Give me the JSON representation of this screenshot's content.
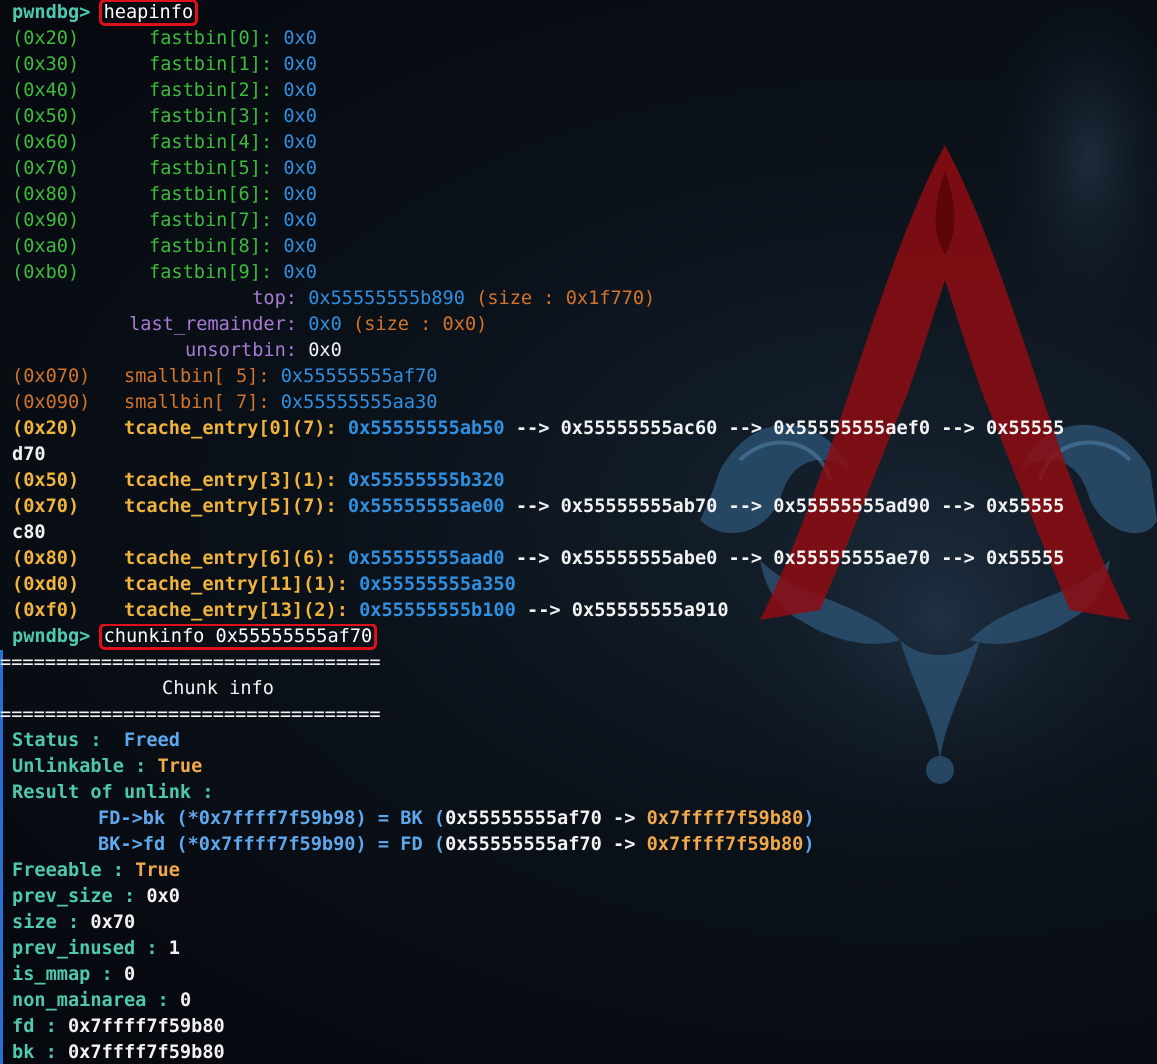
{
  "prompt": "pwndbg>",
  "commands": {
    "heapinfo": "heapinfo",
    "chunkinfo": "chunkinfo 0x55555555af70"
  },
  "fastbins": [
    {
      "size": "(0x20)",
      "label": "fastbin[0]:",
      "value": "0x0"
    },
    {
      "size": "(0x30)",
      "label": "fastbin[1]:",
      "value": "0x0"
    },
    {
      "size": "(0x40)",
      "label": "fastbin[2]:",
      "value": "0x0"
    },
    {
      "size": "(0x50)",
      "label": "fastbin[3]:",
      "value": "0x0"
    },
    {
      "size": "(0x60)",
      "label": "fastbin[4]:",
      "value": "0x0"
    },
    {
      "size": "(0x70)",
      "label": "fastbin[5]:",
      "value": "0x0"
    },
    {
      "size": "(0x80)",
      "label": "fastbin[6]:",
      "value": "0x0"
    },
    {
      "size": "(0x90)",
      "label": "fastbin[7]:",
      "value": "0x0"
    },
    {
      "size": "(0xa0)",
      "label": "fastbin[8]:",
      "value": "0x0"
    },
    {
      "size": "(0xb0)",
      "label": "fastbin[9]:",
      "value": "0x0"
    }
  ],
  "top": {
    "label": "top:",
    "addr": "0x55555555b890",
    "size": "(size : 0x1f770)"
  },
  "last_remainder": {
    "label": "last_remainder:",
    "addr": "0x0",
    "size": "(size : 0x0)"
  },
  "unsortbin": {
    "label": "unsortbin:",
    "addr": "0x0"
  },
  "smallbins": [
    {
      "size": "(0x070)",
      "label": "smallbin[ 5]:",
      "addr": "0x55555555af70"
    },
    {
      "size": "(0x090)",
      "label": "smallbin[ 7]:",
      "addr": "0x55555555aa30"
    }
  ],
  "tcache": [
    {
      "size": "(0x20)",
      "label": "tcache_entry[0](7):",
      "first": "0x55555555ab50",
      "rest": " --> 0x55555555ac60 --> 0x55555555aef0 --> 0x55555",
      "wrap": "d70"
    },
    {
      "size": "(0x50)",
      "label": "tcache_entry[3](1):",
      "first": "0x55555555b320",
      "rest": "",
      "wrap": ""
    },
    {
      "size": "(0x70)",
      "label": "tcache_entry[5](7):",
      "first": "0x55555555ae00",
      "rest": " --> 0x55555555ab70 --> 0x55555555ad90 --> 0x55555",
      "wrap": "c80"
    },
    {
      "size": "(0x80)",
      "label": "tcache_entry[6](6):",
      "first": "0x55555555aad0",
      "rest": " --> 0x55555555abe0 --> 0x55555555ae70 --> 0x55555",
      "wrap": ""
    },
    {
      "size": "(0xd0)",
      "label": "tcache_entry[11](1):",
      "first": "0x55555555a350",
      "rest": "",
      "wrap": ""
    },
    {
      "size": "(0xf0)",
      "label": "tcache_entry[13](2):",
      "first": "0x55555555b100",
      "rest": " --> 0x55555555a910",
      "wrap": ""
    }
  ],
  "chunk": {
    "separator": "==================================",
    "title": "Chunk info",
    "status_label": "Status :",
    "status_value": "Freed",
    "unlinkable_label": "Unlinkable :",
    "unlinkable_value": "True",
    "result_label": "Result of unlink :",
    "fd_bk": {
      "left": "FD->bk",
      "open": "(*",
      "addr": "0x7ffff7f59b98",
      "close": ")",
      "eq": "= BK (",
      "src": "0x55555555af70",
      "arrow": "->",
      "dst": "0x7ffff7f59b80",
      "end": ")"
    },
    "bk_fd": {
      "left": "BK->fd",
      "open": "(*",
      "addr": "0x7ffff7f59b90",
      "close": ")",
      "eq": "= FD (",
      "src": "0x55555555af70",
      "arrow": "->",
      "dst": "0x7ffff7f59b80",
      "end": ")"
    },
    "fields": [
      {
        "label": "Freeable :",
        "value": "True",
        "gold": true
      },
      {
        "label": "prev_size :",
        "value": "0x0",
        "gold": false
      },
      {
        "label": "size :",
        "value": "0x70",
        "gold": false
      },
      {
        "label": "prev_inused :",
        "value": "1",
        "gold": false
      },
      {
        "label": "is_mmap :",
        "value": "0",
        "gold": false
      },
      {
        "label": "non_mainarea :",
        "value": "0",
        "gold": false
      },
      {
        "label": "fd :",
        "value": "0x7ffff7f59b80",
        "gold": false
      },
      {
        "label": "bk :",
        "value": "0x7ffff7f59b80",
        "gold": false
      }
    ]
  },
  "colors": {
    "prompt": "#4ec9b0",
    "highlight_box": "#e0101a",
    "green": "#3dbb3d",
    "blue": "#2f8fe0",
    "orange": "#d3742a",
    "purple": "#a97ad6",
    "yellow": "#f0b43c",
    "background": "#070b12"
  }
}
